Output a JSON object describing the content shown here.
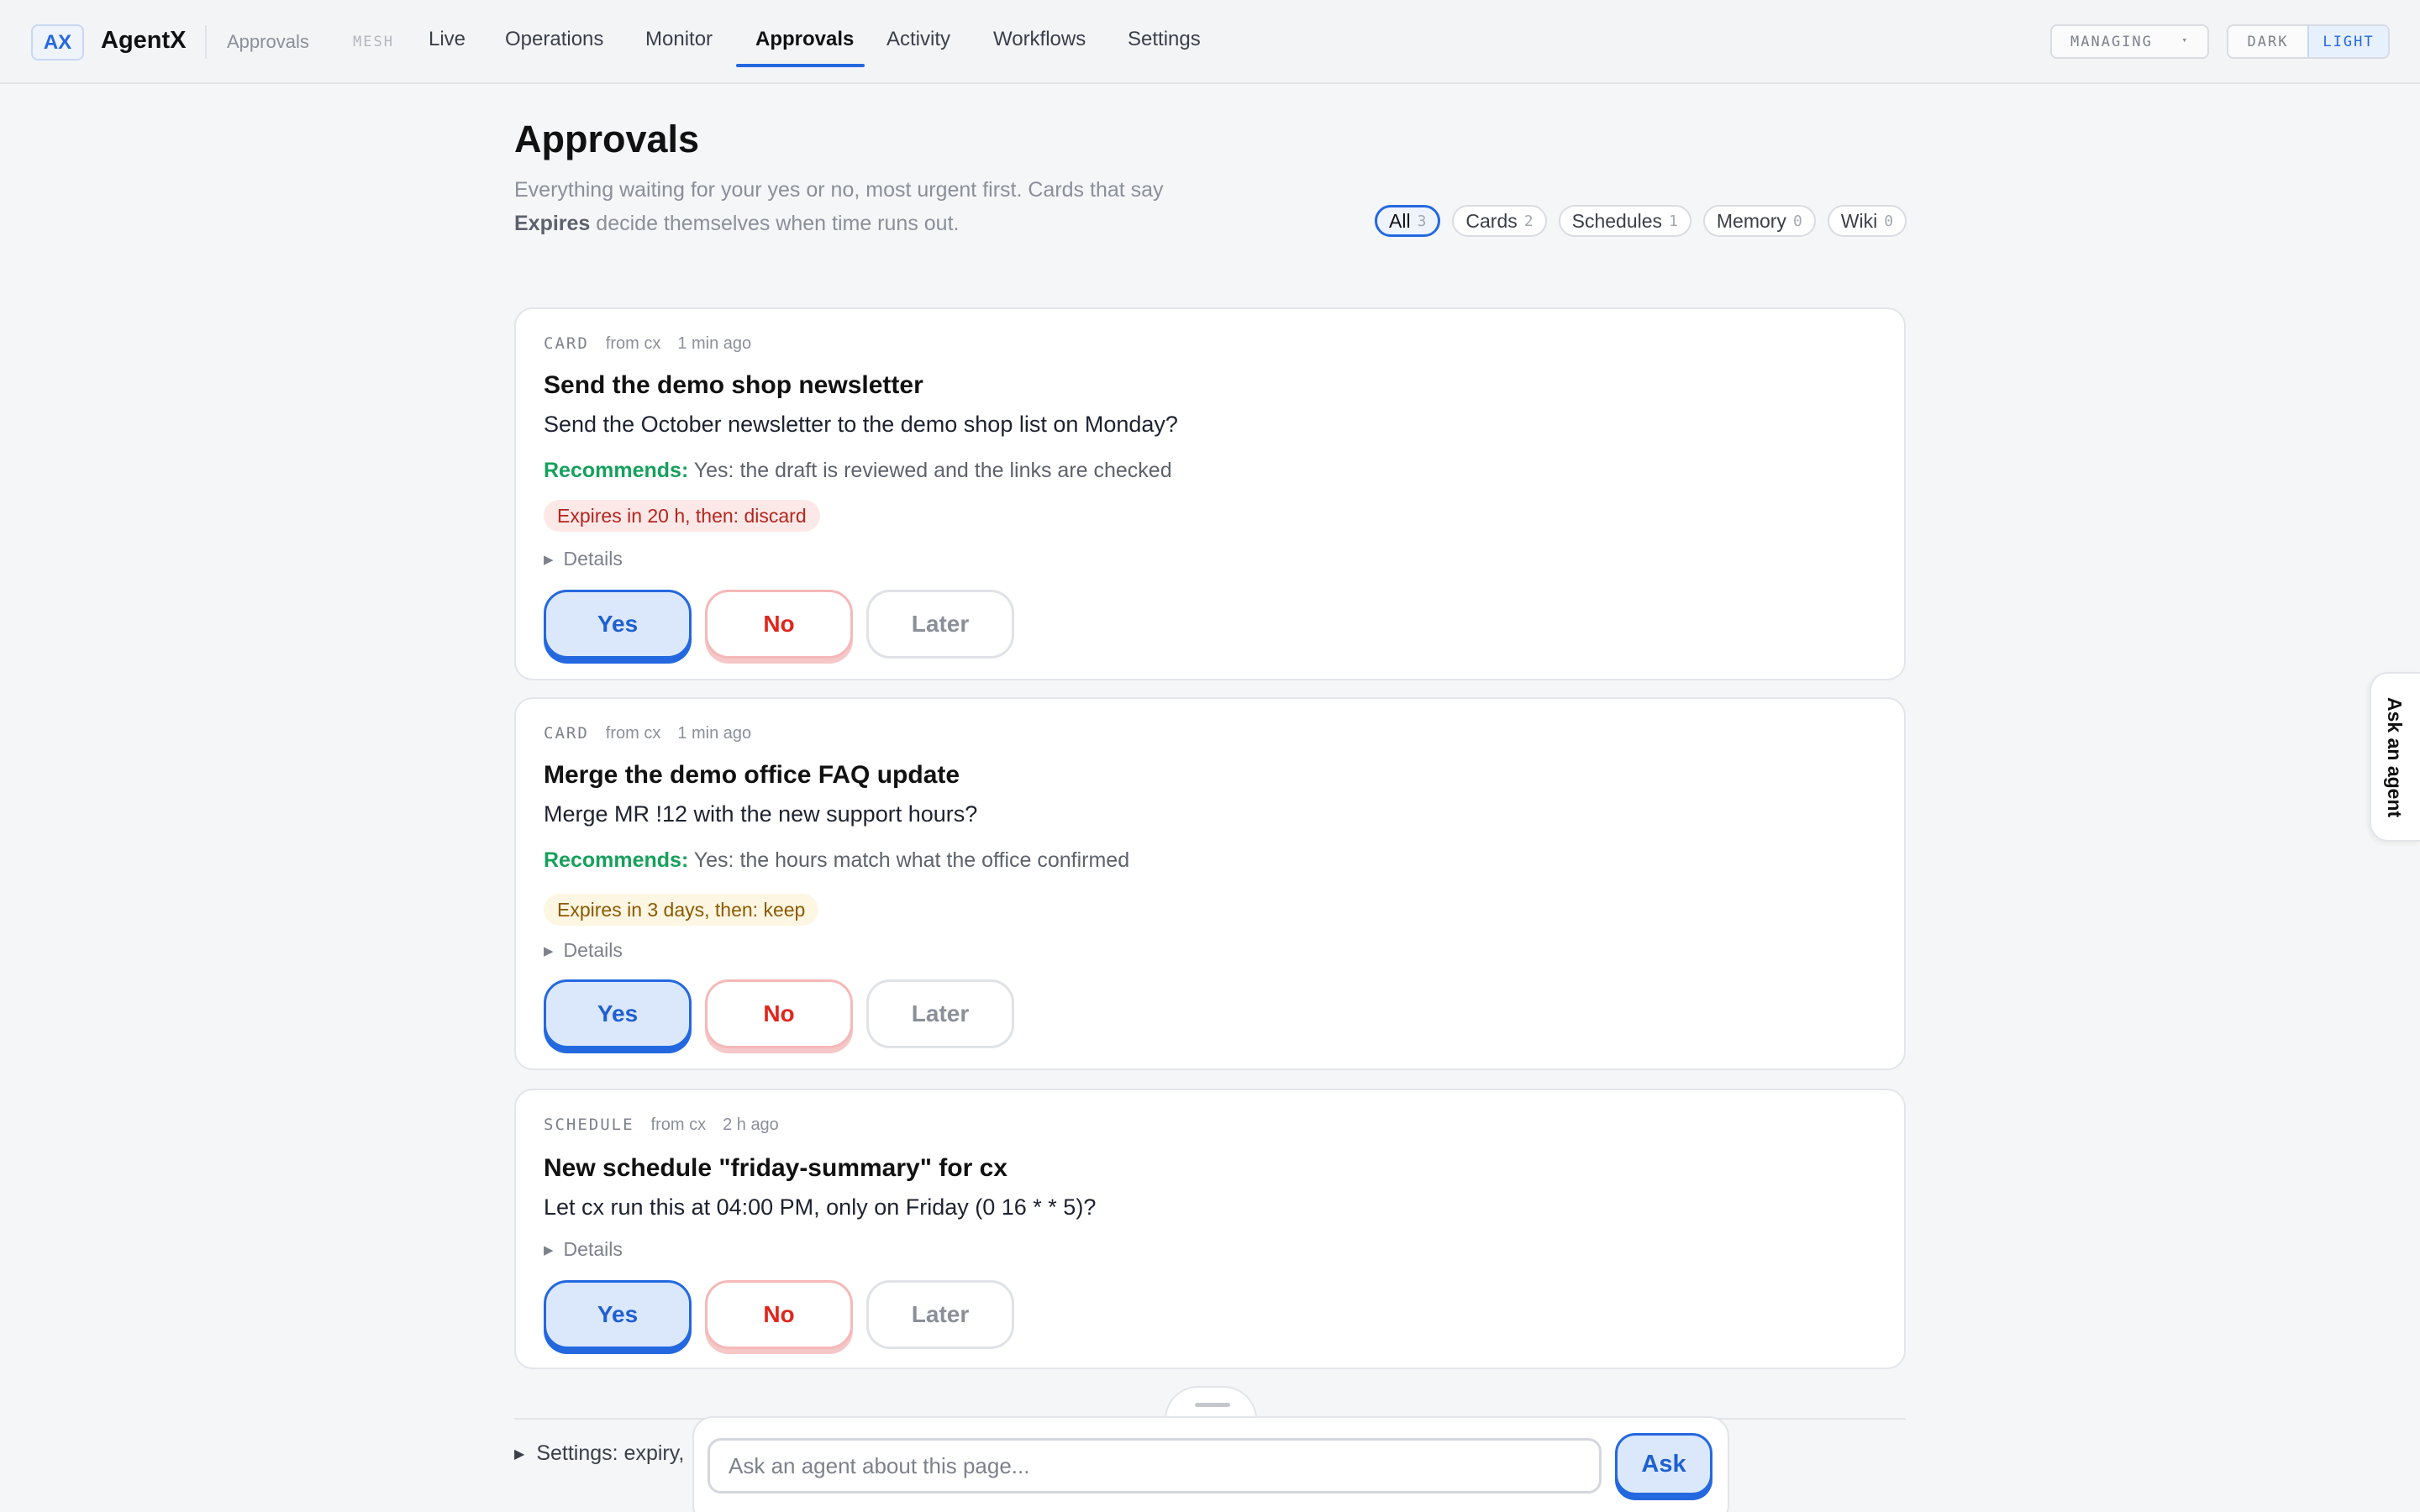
{
  "app": {
    "logo": "AX",
    "name": "AgentX",
    "crumb": "Approvals",
    "mesh": "MESH"
  },
  "nav": {
    "tabs": [
      {
        "label": "Live",
        "active": false
      },
      {
        "label": "Operations",
        "active": false
      },
      {
        "label": "Monitor",
        "active": false
      },
      {
        "label": "Approvals",
        "active": true
      },
      {
        "label": "Activity",
        "active": false
      },
      {
        "label": "Workflows",
        "active": false
      },
      {
        "label": "Settings",
        "active": false
      }
    ]
  },
  "topright": {
    "managing": "MANAGING",
    "theme_dark": "DARK",
    "theme_light": "LIGHT",
    "theme_active": "LIGHT"
  },
  "header": {
    "title": "Approvals",
    "subtitle_1": "Everything waiting for your yes or no, most urgent first. Cards that say",
    "subtitle_bold": "Expires",
    "subtitle_2": "decide themselves when time runs out."
  },
  "filters": [
    {
      "label": "All",
      "count": "3",
      "active": true
    },
    {
      "label": "Cards",
      "count": "2",
      "active": false
    },
    {
      "label": "Schedules",
      "count": "1",
      "active": false
    },
    {
      "label": "Memory",
      "count": "0",
      "active": false
    },
    {
      "label": "Wiki",
      "count": "0",
      "active": false
    }
  ],
  "cards": [
    {
      "kind": "CARD",
      "source": "from cx",
      "time": "1 min ago",
      "title": "Send the demo shop newsletter",
      "question": "Send the October newsletter to the demo shop list on Monday?",
      "recommends_label": "Recommends:",
      "recommends": "Yes: the draft is reviewed and the links are checked",
      "expires": "Expires in 20 h, then: discard",
      "expires_tone": "red",
      "details": "Details",
      "yes": "Yes",
      "no": "No",
      "later": "Later"
    },
    {
      "kind": "CARD",
      "source": "from cx",
      "time": "1 min ago",
      "title": "Merge the demo office FAQ update",
      "question": "Merge MR !12 with the new support hours?",
      "recommends_label": "Recommends:",
      "recommends": "Yes: the hours match what the office confirmed",
      "expires": "Expires in 3 days, then: keep",
      "expires_tone": "amber",
      "details": "Details",
      "yes": "Yes",
      "no": "No",
      "later": "Later"
    },
    {
      "kind": "SCHEDULE",
      "source": "from cx",
      "time": "2 h ago",
      "title": "New schedule \"friday-summary\" for cx",
      "question": "Let cx run this at 04:00 PM, only on Friday (0 16 * * 5)?",
      "details": "Details",
      "yes": "Yes",
      "no": "No",
      "later": "Later"
    }
  ],
  "bottom": {
    "settings_summary": "Settings: expiry,",
    "ask_placeholder": "Ask an agent about this page...",
    "ask_button": "Ask"
  },
  "side_tab": "Ask an agent"
}
